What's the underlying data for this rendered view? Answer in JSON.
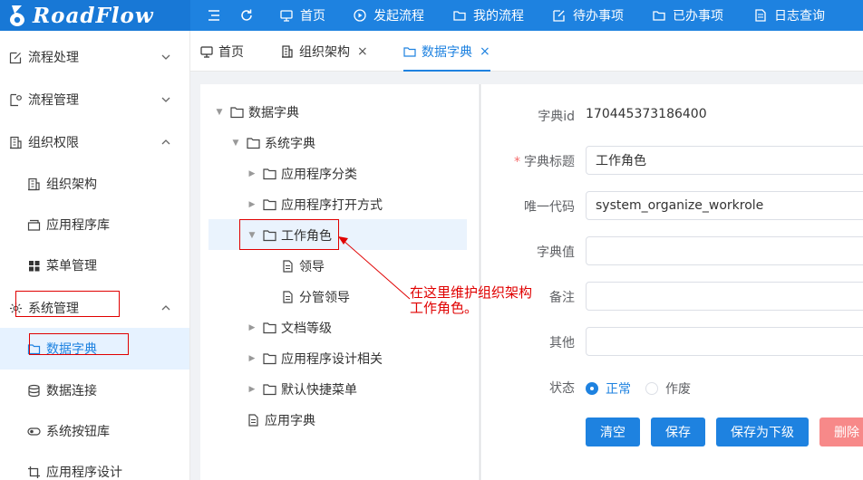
{
  "app": {
    "logo_text": "RoadFlow"
  },
  "topnav": {
    "items": [
      {
        "label": "首页",
        "icon": "monitor-icon"
      },
      {
        "label": "发起流程",
        "icon": "play-circle-icon"
      },
      {
        "label": "我的流程",
        "icon": "folder-icon"
      },
      {
        "label": "待办事项",
        "icon": "edit-icon"
      },
      {
        "label": "已办事项",
        "icon": "folder-icon"
      },
      {
        "label": "日志查询",
        "icon": "document-icon"
      }
    ]
  },
  "sidebar": {
    "items": [
      {
        "label": "流程处理",
        "icon": "edit-icon"
      },
      {
        "label": "流程管理",
        "icon": "doc-gear-icon"
      },
      {
        "label": "组织权限",
        "icon": "building-icon"
      },
      {
        "label": "组织架构",
        "icon": "building-icon"
      },
      {
        "label": "应用程序库",
        "icon": "box-icon"
      },
      {
        "label": "菜单管理",
        "icon": "grid-icon"
      },
      {
        "label": "系统管理",
        "icon": "gear-icon"
      },
      {
        "label": "数据字典",
        "icon": "folder-icon"
      },
      {
        "label": "数据连接",
        "icon": "database-icon"
      },
      {
        "label": "系统按钮库",
        "icon": "toggle-icon"
      },
      {
        "label": "应用程序设计",
        "icon": "crop-icon"
      }
    ]
  },
  "tabs": [
    {
      "label": "首页",
      "icon": "monitor-icon",
      "closable": false
    },
    {
      "label": "组织架构",
      "icon": "building-icon",
      "closable": true
    },
    {
      "label": "数据字典",
      "icon": "folder-icon",
      "closable": true,
      "active": true
    }
  ],
  "tab_close_glyph": "×",
  "tree": {
    "nodes": [
      {
        "label": "数据字典",
        "expanded": true
      },
      {
        "label": "系统字典",
        "expanded": true
      },
      {
        "label": "应用程序分类"
      },
      {
        "label": "应用程序打开方式"
      },
      {
        "label": "工作角色",
        "expanded": true,
        "selected": true
      },
      {
        "label": "领导"
      },
      {
        "label": "分管领导"
      },
      {
        "label": "文档等级"
      },
      {
        "label": "应用程序设计相关"
      },
      {
        "label": "默认快捷菜单"
      },
      {
        "label": "应用字典"
      }
    ]
  },
  "form": {
    "id_label": "字典id",
    "id_value": "170445373186400",
    "title_label": "字典标题",
    "title_required_mark": "*",
    "title_value": "工作角色",
    "code_label": "唯一代码",
    "code_value": "system_organize_workrole",
    "value_label": "字典值",
    "value_value": "",
    "note_label": "备注",
    "note_value": "",
    "other_label": "其他",
    "other_value": "",
    "status_label": "状态",
    "status_options": [
      "正常",
      "作废"
    ],
    "status_selected": "正常"
  },
  "buttons": {
    "clear": "清空",
    "save": "保存",
    "save_child": "保存为下级",
    "delete": "删除"
  },
  "annotation": {
    "line1": "在这里维护组织架构",
    "line2": "工作角色。"
  },
  "colors": {
    "primary": "#1e82e0",
    "danger": "#f78989",
    "annotation": "#e00000"
  }
}
